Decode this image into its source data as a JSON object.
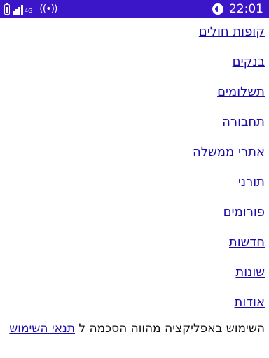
{
  "status_bar": {
    "network_type": "4G",
    "time": "22:01",
    "hotspot_icon": "((•))"
  },
  "menu": {
    "items": [
      {
        "label": "קופות חולים"
      },
      {
        "label": "בנקים"
      },
      {
        "label": "תשלומים"
      },
      {
        "label": "תחבורה"
      },
      {
        "label": "אתרי ממשלה"
      },
      {
        "label": "תורני"
      },
      {
        "label": "פורומים"
      },
      {
        "label": "חדשות"
      },
      {
        "label": "שונות"
      },
      {
        "label": "אודות"
      }
    ]
  },
  "footer": {
    "text": "השימוש באפליקציה מהווה הסכמה ל ",
    "terms_link": "תנאי השימוש"
  },
  "colors": {
    "status_bar": "#3a16c8",
    "link": "#1a0dab"
  }
}
